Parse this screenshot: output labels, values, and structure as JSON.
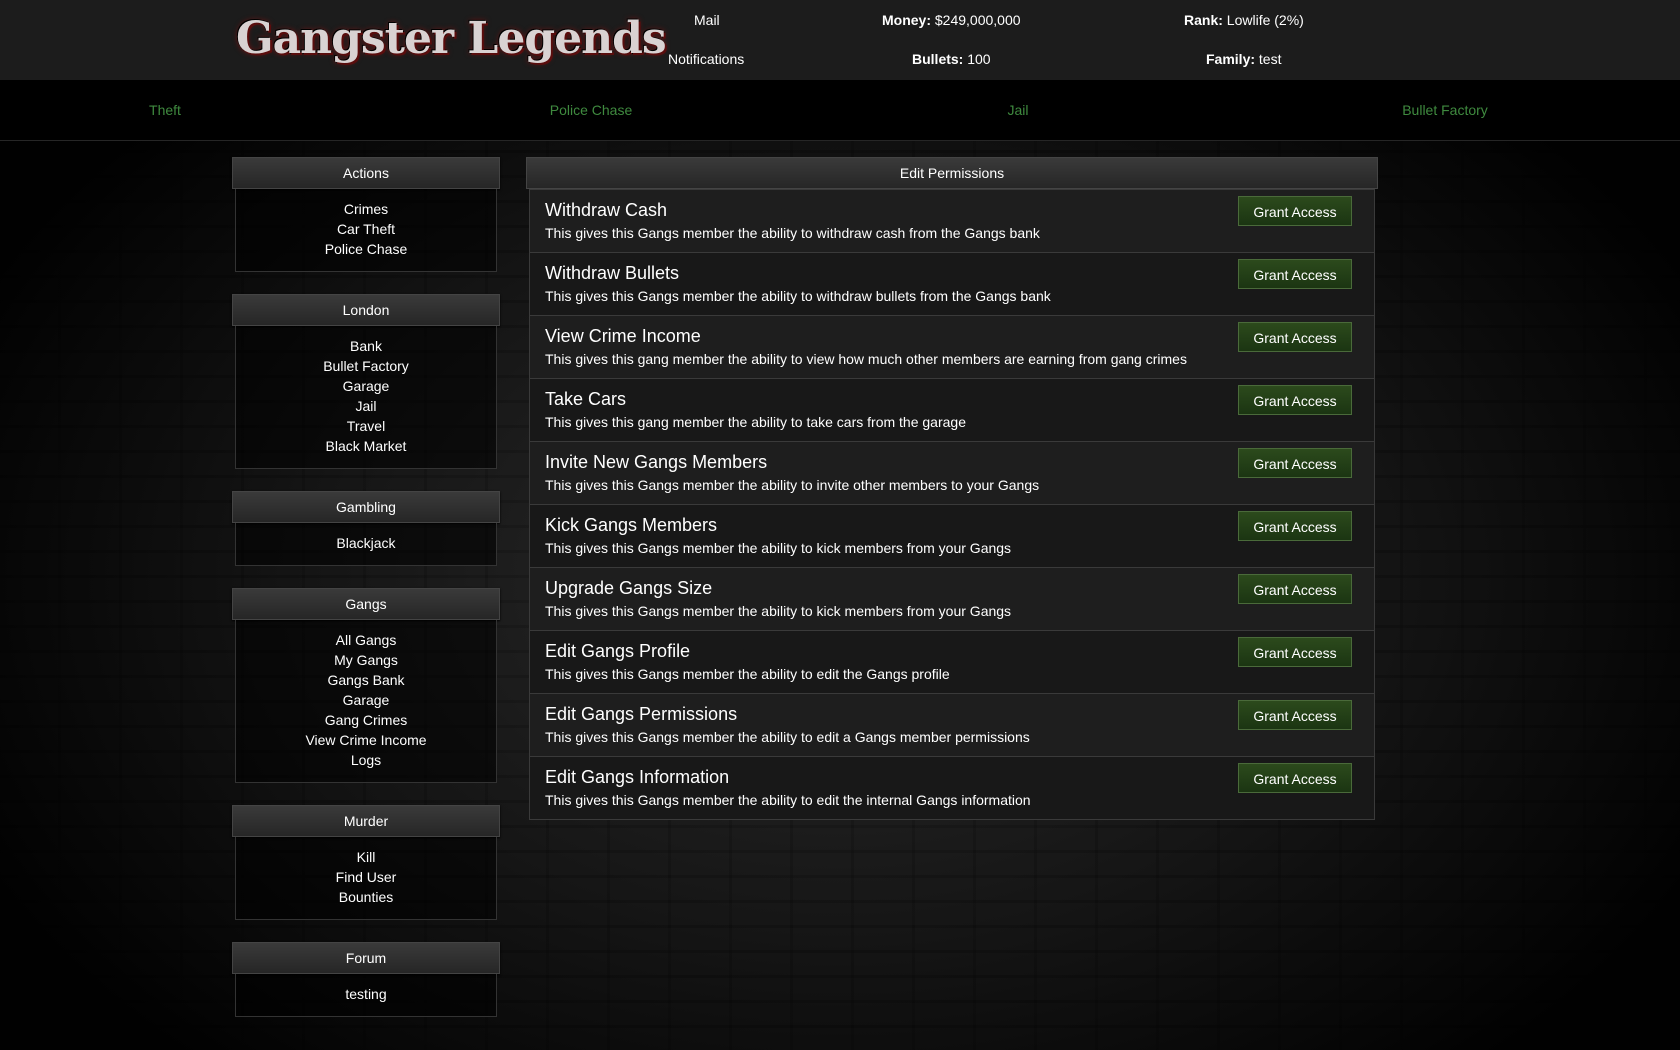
{
  "header": {
    "logo": "Gangster Legends",
    "mail": "Mail",
    "notifications": "Notifications",
    "money_label": "Money:",
    "money_value": "$249,000,000",
    "bullets_label": "Bullets:",
    "bullets_value": "100",
    "rank_label": "Rank:",
    "rank_value": "Lowlife (2%)",
    "family_label": "Family:",
    "family_value": "test"
  },
  "nav": [
    "Theft",
    "Police Chase",
    "Jail",
    "Bullet Factory"
  ],
  "colors": {
    "nav_link": "#3f8a3f",
    "button_green": "#2c4a1c"
  },
  "sidebar": [
    {
      "title": "Actions",
      "items": [
        "Crimes",
        "Car Theft",
        "Police Chase"
      ]
    },
    {
      "title": "London",
      "items": [
        "Bank",
        "Bullet Factory",
        "Garage",
        "Jail",
        "Travel",
        "Black Market"
      ]
    },
    {
      "title": "Gambling",
      "items": [
        "Blackjack"
      ]
    },
    {
      "title": "Gangs",
      "items": [
        "All Gangs",
        "My Gangs",
        "Gangs Bank",
        "Garage",
        "Gang Crimes",
        "View Crime Income",
        "Logs"
      ]
    },
    {
      "title": "Murder",
      "items": [
        "Kill",
        "Find User",
        "Bounties"
      ]
    },
    {
      "title": "Forum",
      "items": [
        "testing"
      ]
    }
  ],
  "main": {
    "title": "Edit Permissions",
    "button_label": "Grant Access",
    "permissions": [
      {
        "title": "Withdraw Cash",
        "desc": "This gives this Gangs member the ability to withdraw cash from the Gangs bank"
      },
      {
        "title": "Withdraw Bullets",
        "desc": "This gives this Gangs member the ability to withdraw bullets from the Gangs bank"
      },
      {
        "title": "View Crime Income",
        "desc": "This gives this gang member the ability to view how much other members are earning from gang crimes"
      },
      {
        "title": "Take Cars",
        "desc": "This gives this gang member the ability to take cars from the garage"
      },
      {
        "title": "Invite New Gangs Members",
        "desc": "This gives this Gangs member the ability to invite other members to your Gangs"
      },
      {
        "title": "Kick Gangs Members",
        "desc": "This gives this Gangs member the ability to kick members from your Gangs"
      },
      {
        "title": "Upgrade Gangs Size",
        "desc": "This gives this Gangs member the ability to kick members from your Gangs"
      },
      {
        "title": "Edit Gangs Profile",
        "desc": "This gives this Gangs member the ability to edit the Gangs profile"
      },
      {
        "title": "Edit Gangs Permissions",
        "desc": "This gives this Gangs member the ability to edit a Gangs member permissions"
      },
      {
        "title": "Edit Gangs Information",
        "desc": "This gives this Gangs member the ability to edit the internal Gangs information"
      }
    ]
  }
}
